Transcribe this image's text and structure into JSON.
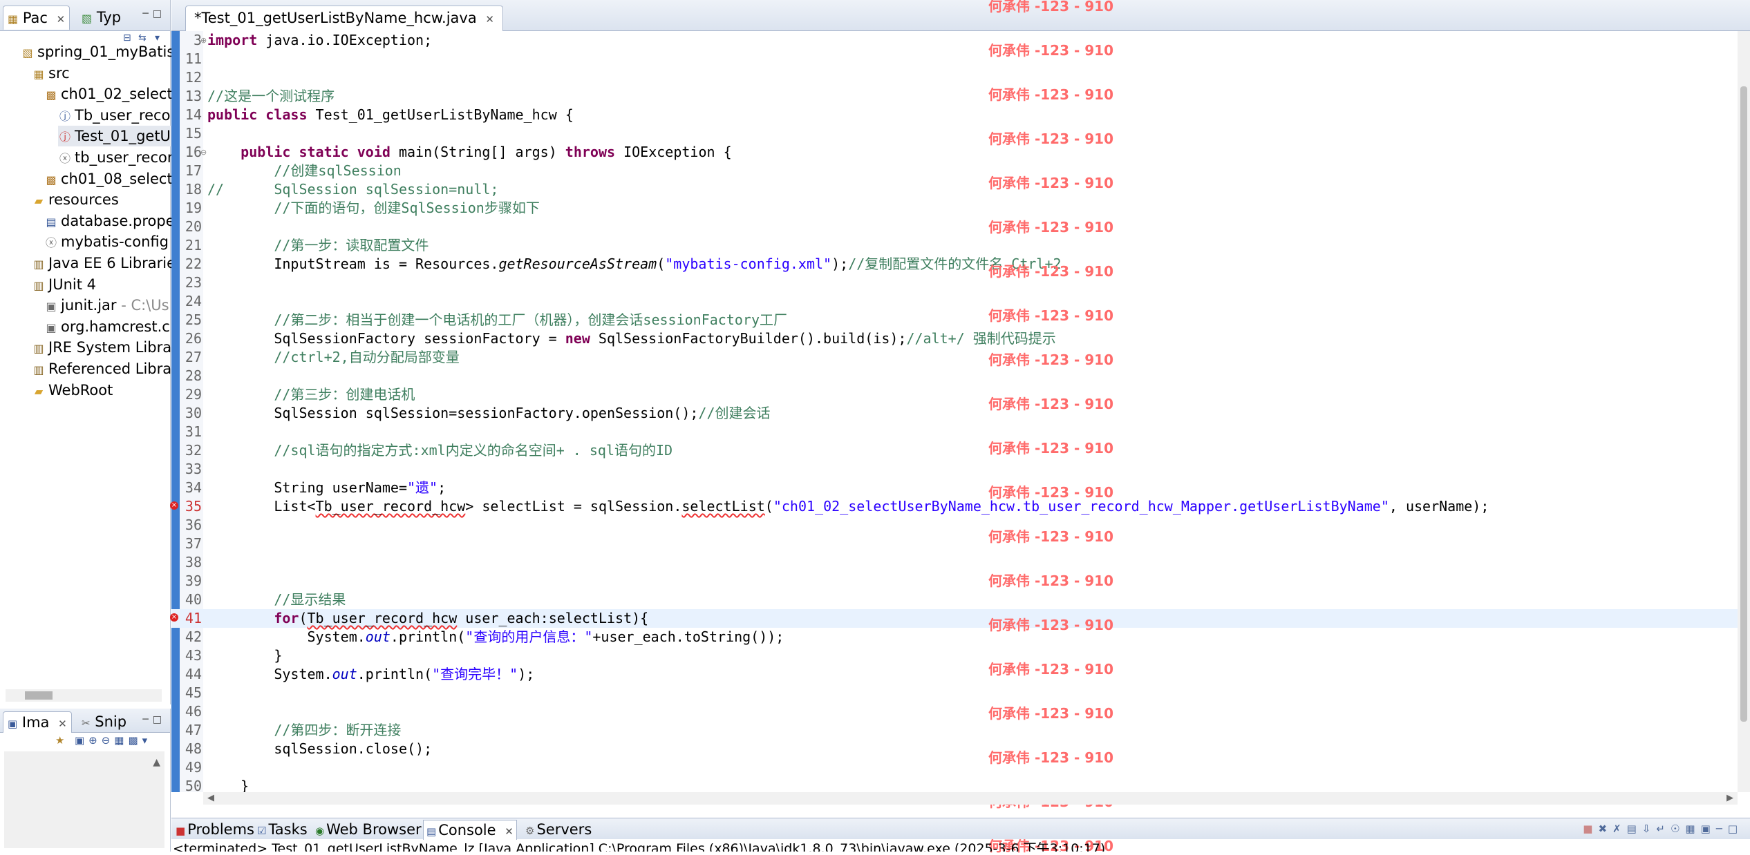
{
  "left_panel": {
    "tabs": [
      {
        "label": "Pac",
        "icon": "package-explorer-icon"
      },
      {
        "label": "Typ",
        "icon": "type-hierarchy-icon"
      }
    ],
    "tree": [
      {
        "label": "spring_01_myBatis_",
        "suffix": "",
        "icon": "project-icon"
      },
      {
        "label": "src",
        "suffix": "",
        "icon": "source-folder-icon"
      },
      {
        "label": "ch01_02_select",
        "suffix": "",
        "icon": "package-icon"
      },
      {
        "label": "Tb_user_reco",
        "suffix": "",
        "icon": "java-file-icon"
      },
      {
        "label": "Test_01_getU",
        "suffix": "",
        "icon": "java-file-error-icon"
      },
      {
        "label": "tb_user_recor",
        "suffix": "",
        "icon": "xml-file-icon"
      },
      {
        "label": "ch01_08_select",
        "suffix": "",
        "icon": "package-icon"
      },
      {
        "label": "resources",
        "suffix": "",
        "icon": "folder-icon"
      },
      {
        "label": "database.prope",
        "suffix": "",
        "icon": "properties-file-icon"
      },
      {
        "label": "mybatis-config",
        "suffix": "",
        "icon": "xml-file-icon"
      },
      {
        "label": "Java EE 6 Librarie",
        "suffix": "",
        "icon": "library-icon"
      },
      {
        "label": "JUnit 4",
        "suffix": "",
        "icon": "library-icon"
      },
      {
        "label": "junit.jar",
        "suffix": " - C:\\Us",
        "icon": "jar-icon"
      },
      {
        "label": "org.hamcrest.c",
        "suffix": "",
        "icon": "jar-icon"
      },
      {
        "label": "JRE System Libra",
        "suffix": "",
        "icon": "library-icon"
      },
      {
        "label": "Referenced Libra",
        "suffix": "",
        "icon": "library-icon"
      },
      {
        "label": "WebRoot",
        "suffix": "",
        "icon": "folder-icon"
      }
    ],
    "bottom_tabs": [
      {
        "label": "Ima",
        "icon": "image-view-icon"
      },
      {
        "label": "Snip",
        "icon": "snippets-icon"
      }
    ]
  },
  "editor": {
    "tab_label": "*Test_01_getUserListByName_hcw.java",
    "watermark": "何承伟 -123 - 910",
    "lines": [
      {
        "n": "3",
        "fold": "⊕",
        "tokens": [
          {
            "t": "import",
            "c": "kw"
          },
          {
            "t": " java.io.IOException;"
          }
        ]
      },
      {
        "n": "11",
        "tokens": []
      },
      {
        "n": "12",
        "tokens": []
      },
      {
        "n": "13",
        "tokens": [
          {
            "t": "//这是一个测试程序",
            "c": "cm"
          }
        ]
      },
      {
        "n": "14",
        "tokens": [
          {
            "t": "public class",
            "c": "kw"
          },
          {
            "t": " Test_01_getUserListByName_hcw {"
          }
        ]
      },
      {
        "n": "15",
        "tokens": []
      },
      {
        "n": "16",
        "fold": "⊖",
        "tokens": [
          {
            "t": "    "
          },
          {
            "t": "public static void",
            "c": "kw"
          },
          {
            "t": " main(String[] args) "
          },
          {
            "t": "throws",
            "c": "kw"
          },
          {
            "t": " IOException {"
          }
        ]
      },
      {
        "n": "17",
        "tokens": [
          {
            "t": "        "
          },
          {
            "t": "//创建sqlSession",
            "c": "cm"
          }
        ]
      },
      {
        "n": "18",
        "tokens": [
          {
            "t": "//      SqlSession sqlSession=null;",
            "c": "cm"
          }
        ]
      },
      {
        "n": "19",
        "tokens": [
          {
            "t": "        "
          },
          {
            "t": "//下面的语句，创建SqlSession步骤如下",
            "c": "cm"
          }
        ]
      },
      {
        "n": "20",
        "tokens": []
      },
      {
        "n": "21",
        "tokens": [
          {
            "t": "        "
          },
          {
            "t": "//第一步：读取配置文件",
            "c": "cm"
          }
        ]
      },
      {
        "n": "22",
        "tokens": [
          {
            "t": "        InputStream is = Resources."
          },
          {
            "t": "getResourceAsStream",
            "c": "itl"
          },
          {
            "t": "("
          },
          {
            "t": "\"mybatis-config.xml\"",
            "c": "str"
          },
          {
            "t": ");"
          },
          {
            "t": "//复制配置文件的文件名 Ctrl+2",
            "c": "cm"
          }
        ]
      },
      {
        "n": "23",
        "tokens": []
      },
      {
        "n": "24",
        "tokens": []
      },
      {
        "n": "25",
        "tokens": [
          {
            "t": "        "
          },
          {
            "t": "//第二步：相当于创建一个电话机的工厂（机器），创建会话sessionFactory工厂",
            "c": "cm"
          }
        ]
      },
      {
        "n": "26",
        "tokens": [
          {
            "t": "        SqlSessionFactory sessionFactory = "
          },
          {
            "t": "new",
            "c": "kw"
          },
          {
            "t": " SqlSessionFactoryBuilder().build(is);"
          },
          {
            "t": "//alt+/ 强制代码提示",
            "c": "cm"
          }
        ]
      },
      {
        "n": "27",
        "tokens": [
          {
            "t": "        "
          },
          {
            "t": "//ctrl+2,自动分配局部变量",
            "c": "cm"
          }
        ]
      },
      {
        "n": "28",
        "tokens": []
      },
      {
        "n": "29",
        "tokens": [
          {
            "t": "        "
          },
          {
            "t": "//第三步：创建电话机",
            "c": "cm"
          }
        ]
      },
      {
        "n": "30",
        "tokens": [
          {
            "t": "        SqlSession sqlSession=sessionFactory.openSession();"
          },
          {
            "t": "//创建会话",
            "c": "cm"
          }
        ]
      },
      {
        "n": "31",
        "tokens": []
      },
      {
        "n": "32",
        "tokens": [
          {
            "t": "        "
          },
          {
            "t": "//sql语句的指定方式:xml内定义的命名空间+ . sql语句的ID",
            "c": "cm"
          }
        ]
      },
      {
        "n": "33",
        "tokens": []
      },
      {
        "n": "34",
        "tokens": [
          {
            "t": "        String userName="
          },
          {
            "t": "\"遗\"",
            "c": "str"
          },
          {
            "t": ";"
          }
        ]
      },
      {
        "n": "35",
        "err": true,
        "tokens": [
          {
            "t": "        List<"
          },
          {
            "t": "Tb_user_record_hcw",
            "c": "squig"
          },
          {
            "t": "> selectList = sqlSession."
          },
          {
            "t": "selectList",
            "c": "squig"
          },
          {
            "t": "("
          },
          {
            "t": "\"ch01_02_selectUserByName_hcw.tb_user_record_hcw_Mapper.getUserListByName\"",
            "c": "str"
          },
          {
            "t": ", userName);"
          }
        ]
      },
      {
        "n": "36",
        "tokens": []
      },
      {
        "n": "37",
        "tokens": []
      },
      {
        "n": "38",
        "tokens": []
      },
      {
        "n": "39",
        "tokens": []
      },
      {
        "n": "40",
        "tokens": [
          {
            "t": "        "
          },
          {
            "t": "//显示结果",
            "c": "cm"
          }
        ]
      },
      {
        "n": "41",
        "err": true,
        "current": true,
        "tokens": [
          {
            "t": "        "
          },
          {
            "t": "for",
            "c": "kw"
          },
          {
            "t": "("
          },
          {
            "t": "Tb_user_record_hcw",
            "c": "squig"
          },
          {
            "t": " user_each:selectList){"
          }
        ]
      },
      {
        "n": "42",
        "tokens": [
          {
            "t": "            System."
          },
          {
            "t": "out",
            "c": "fld"
          },
          {
            "t": ".println("
          },
          {
            "t": "\"查询的用户信息：\"",
            "c": "str"
          },
          {
            "t": "+user_each.toString());"
          }
        ]
      },
      {
        "n": "43",
        "tokens": [
          {
            "t": "        }"
          }
        ]
      },
      {
        "n": "44",
        "tokens": [
          {
            "t": "        System."
          },
          {
            "t": "out",
            "c": "fld"
          },
          {
            "t": ".println("
          },
          {
            "t": "\"查询完毕！\"",
            "c": "str"
          },
          {
            "t": ");"
          }
        ]
      },
      {
        "n": "45",
        "tokens": []
      },
      {
        "n": "46",
        "tokens": []
      },
      {
        "n": "47",
        "tokens": [
          {
            "t": "        "
          },
          {
            "t": "//第四步：断开连接",
            "c": "cm"
          }
        ]
      },
      {
        "n": "48",
        "tokens": [
          {
            "t": "        sqlSession.close();"
          }
        ]
      },
      {
        "n": "49",
        "tokens": []
      },
      {
        "n": "50",
        "tokens": [
          {
            "t": "    }"
          }
        ]
      }
    ]
  },
  "bottom_panel": {
    "tabs": [
      {
        "label": "Problems",
        "icon": "problems-icon",
        "active": false
      },
      {
        "label": "Tasks",
        "icon": "tasks-icon",
        "active": false
      },
      {
        "label": "Web Browser",
        "icon": "globe-icon",
        "active": false
      },
      {
        "label": "Console",
        "icon": "console-icon",
        "active": true
      },
      {
        "label": "Servers",
        "icon": "servers-icon",
        "active": false
      }
    ],
    "console_text": "<terminated> Test_01_getUserListByName_lz [Java Application] C:\\Program Files (x86)\\Java\\jdk1.8.0_73\\bin\\javaw.exe (2025-3-6 下午3:10:17)"
  },
  "colors": {
    "keyword": "#7f0055",
    "comment": "#3f7f5f",
    "string": "#2a00ff",
    "field": "#0000c0",
    "watermark": "#ff6b6b",
    "ruler": "#3f7fd0"
  }
}
